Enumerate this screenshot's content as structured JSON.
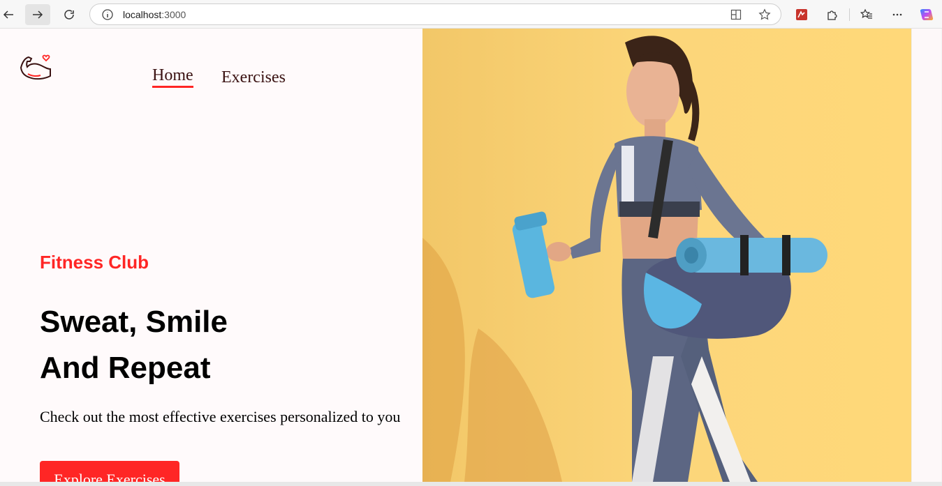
{
  "browser": {
    "url_host": "localhost",
    "url_port": ":3000"
  },
  "nav": {
    "home_label": "Home",
    "exercises_label": "Exercises"
  },
  "hero": {
    "club_label": "Fitness Club",
    "headline_line1": "Sweat, Smile",
    "headline_line2": "And Repeat",
    "subtext": "Check out the most effective exercises personalized to you",
    "cta_label": "Explore Exercises"
  },
  "colors": {
    "accent": "#ff2625",
    "page_bg": "#fffafb",
    "hero_bg": "#fcd67a"
  },
  "icons": [
    "back-arrow-icon",
    "forward-arrow-icon",
    "refresh-icon",
    "info-icon",
    "split-screen-icon",
    "favorite-star-icon",
    "extension-app-icon",
    "puzzle-icon",
    "favorites-icon",
    "more-icon",
    "copilot-icon",
    "gym-logo-icon"
  ]
}
